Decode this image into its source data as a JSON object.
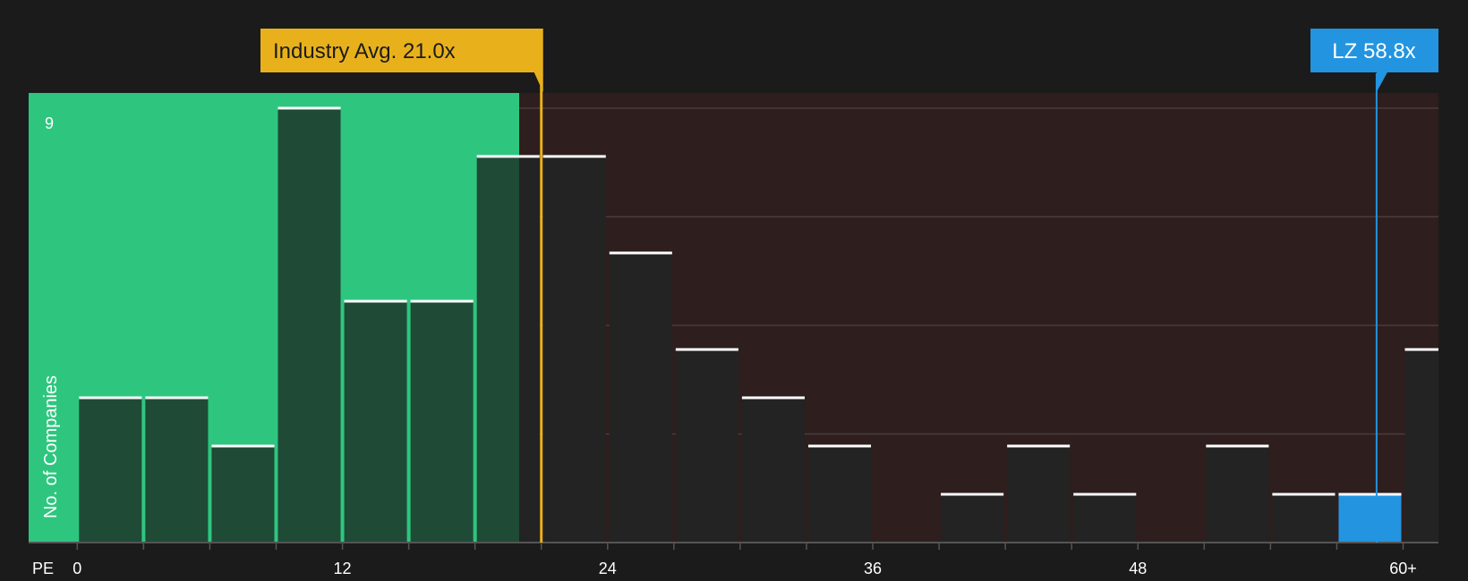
{
  "chart_data": {
    "type": "bar",
    "xlabel": "PE",
    "ylabel": "No. of Companies",
    "x_tick_labels": [
      "0",
      "12",
      "24",
      "36",
      "48",
      "60+"
    ],
    "x_tick_values": [
      0,
      12,
      24,
      36,
      48,
      60
    ],
    "y_tick_label": "9",
    "ylim": [
      0,
      9
    ],
    "xlim": [
      -2.2,
      61.6
    ],
    "bin_width": 3,
    "bins": [
      {
        "start": 0,
        "count": 3
      },
      {
        "start": 3,
        "count": 3
      },
      {
        "start": 6,
        "count": 2
      },
      {
        "start": 9,
        "count": 9
      },
      {
        "start": 12,
        "count": 5
      },
      {
        "start": 15,
        "count": 5
      },
      {
        "start": 18,
        "count": 8
      },
      {
        "start": 21,
        "count": 8
      },
      {
        "start": 24,
        "count": 6
      },
      {
        "start": 27,
        "count": 4
      },
      {
        "start": 30,
        "count": 3
      },
      {
        "start": 33,
        "count": 2
      },
      {
        "start": 36,
        "count": 0
      },
      {
        "start": 39,
        "count": 1
      },
      {
        "start": 42,
        "count": 2
      },
      {
        "start": 45,
        "count": 1
      },
      {
        "start": 48,
        "count": 0
      },
      {
        "start": 51,
        "count": 2
      },
      {
        "start": 54,
        "count": 1
      },
      {
        "start": 57,
        "count": 1,
        "highlight": true
      },
      {
        "start": 60,
        "count": 4
      }
    ],
    "green_zone_end": 20.0,
    "industry_avg": {
      "label": "Industry Avg. 21.0x",
      "value": 21.0
    },
    "company": {
      "label": "LZ 58.8x",
      "value": 58.8
    },
    "colors": {
      "background": "#1b1b1b",
      "green_zone": "#2ec67f",
      "red_zone": "#2e1e1e",
      "bar_dark": "#232323",
      "bar_on_green": "#1f4a36",
      "highlight": "#2394e0",
      "industry_line": "#e8b11c",
      "bar_cap": "#ffffff",
      "grid": "#4a3c3c"
    }
  }
}
